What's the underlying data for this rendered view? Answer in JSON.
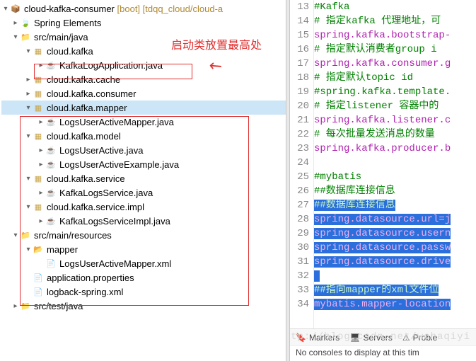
{
  "project": {
    "name": "cloud-kafka-consumer",
    "suffix": "[boot] [tdqq_cloud/cloud-a"
  },
  "tree": {
    "springElements": "Spring Elements",
    "srcMainJava": "src/main/java",
    "pkg_cloudKafka": "cloud.kafka",
    "file_KafkaLogApplication": "KafkaLogApplication.java",
    "pkg_cloudKafkaCache": "cloud.kafka.cache",
    "pkg_cloudKafkaConsumer": "cloud.kafka.consumer",
    "pkg_cloudKafkaMapper": "cloud.kafka.mapper",
    "file_LogsUserActiveMapper": "LogsUserActiveMapper.java",
    "pkg_cloudKafkaModel": "cloud.kafka.model",
    "file_LogsUserActive": "LogsUserActive.java",
    "file_LogsUserActiveExample": "LogsUserActiveExample.java",
    "pkg_cloudKafkaService": "cloud.kafka.service",
    "file_KafkaLogsService": "KafkaLogsService.java",
    "pkg_cloudKafkaServiceImpl": "cloud.kafka.service.impl",
    "file_KafkaLogsServiceImpl": "KafkaLogsServiceImpl.java",
    "srcMainResources": "src/main/resources",
    "folder_mapper": "mapper",
    "file_LogsUserActiveMapperXml": "LogsUserActiveMapper.xml",
    "file_applicationProperties": "application.properties",
    "file_logbackSpringXml": "logback-spring.xml",
    "srcTestJava": "src/test/java"
  },
  "annotation": {
    "text": "启动类放置最高处"
  },
  "editor": {
    "lines": [
      {
        "n": 13,
        "type": "comment",
        "t": "#Kafka"
      },
      {
        "n": 14,
        "type": "comment",
        "t": "# 指定kafka 代理地址，可"
      },
      {
        "n": 15,
        "type": "prop",
        "t": "spring.kafka.bootstrap-"
      },
      {
        "n": 16,
        "type": "comment",
        "t": "# 指定默认消费者group i"
      },
      {
        "n": 17,
        "type": "prop",
        "t": "spring.kafka.consumer.g"
      },
      {
        "n": 18,
        "type": "comment",
        "t": "# 指定默认topic id"
      },
      {
        "n": 19,
        "type": "comment",
        "t": "#spring.kafka.template."
      },
      {
        "n": 20,
        "type": "comment",
        "t": "# 指定listener 容器中的"
      },
      {
        "n": 21,
        "type": "prop",
        "t": "spring.kafka.listener.c"
      },
      {
        "n": 22,
        "type": "comment",
        "t": "# 每次批量发送消息的数量"
      },
      {
        "n": 23,
        "type": "prop",
        "t": "spring.kafka.producer.b"
      },
      {
        "n": 24,
        "type": "blank",
        "t": ""
      },
      {
        "n": 25,
        "type": "comment",
        "t": "#mybatis"
      },
      {
        "n": 26,
        "type": "comment",
        "t": "##数据库连接信息"
      },
      {
        "n": 27,
        "type": "sel-comment",
        "t": "##数据库连接信息"
      },
      {
        "n": 28,
        "type": "sel-prop",
        "t": "spring.datasource.url=j"
      },
      {
        "n": 29,
        "type": "sel-prop",
        "t": "spring.datasource.usern"
      },
      {
        "n": 30,
        "type": "sel-prop",
        "t": "spring.datasource.passw"
      },
      {
        "n": 31,
        "type": "sel-prop",
        "t": "spring.datasource.drive"
      },
      {
        "n": 32,
        "type": "sel-blank",
        "t": " "
      },
      {
        "n": 33,
        "type": "sel-comment",
        "t": "##指向mapper的xml文件位"
      },
      {
        "n": 34,
        "type": "sel-prop",
        "t": "mybatis.mapper-location"
      }
    ]
  },
  "bottomTabs": {
    "markers": "Markers",
    "servers": "Servers",
    "problems": "Proble"
  },
  "bottomMsg": "No consoles to display at this tim",
  "watermark": "http://blog.csdn.net/wohaqiyi"
}
